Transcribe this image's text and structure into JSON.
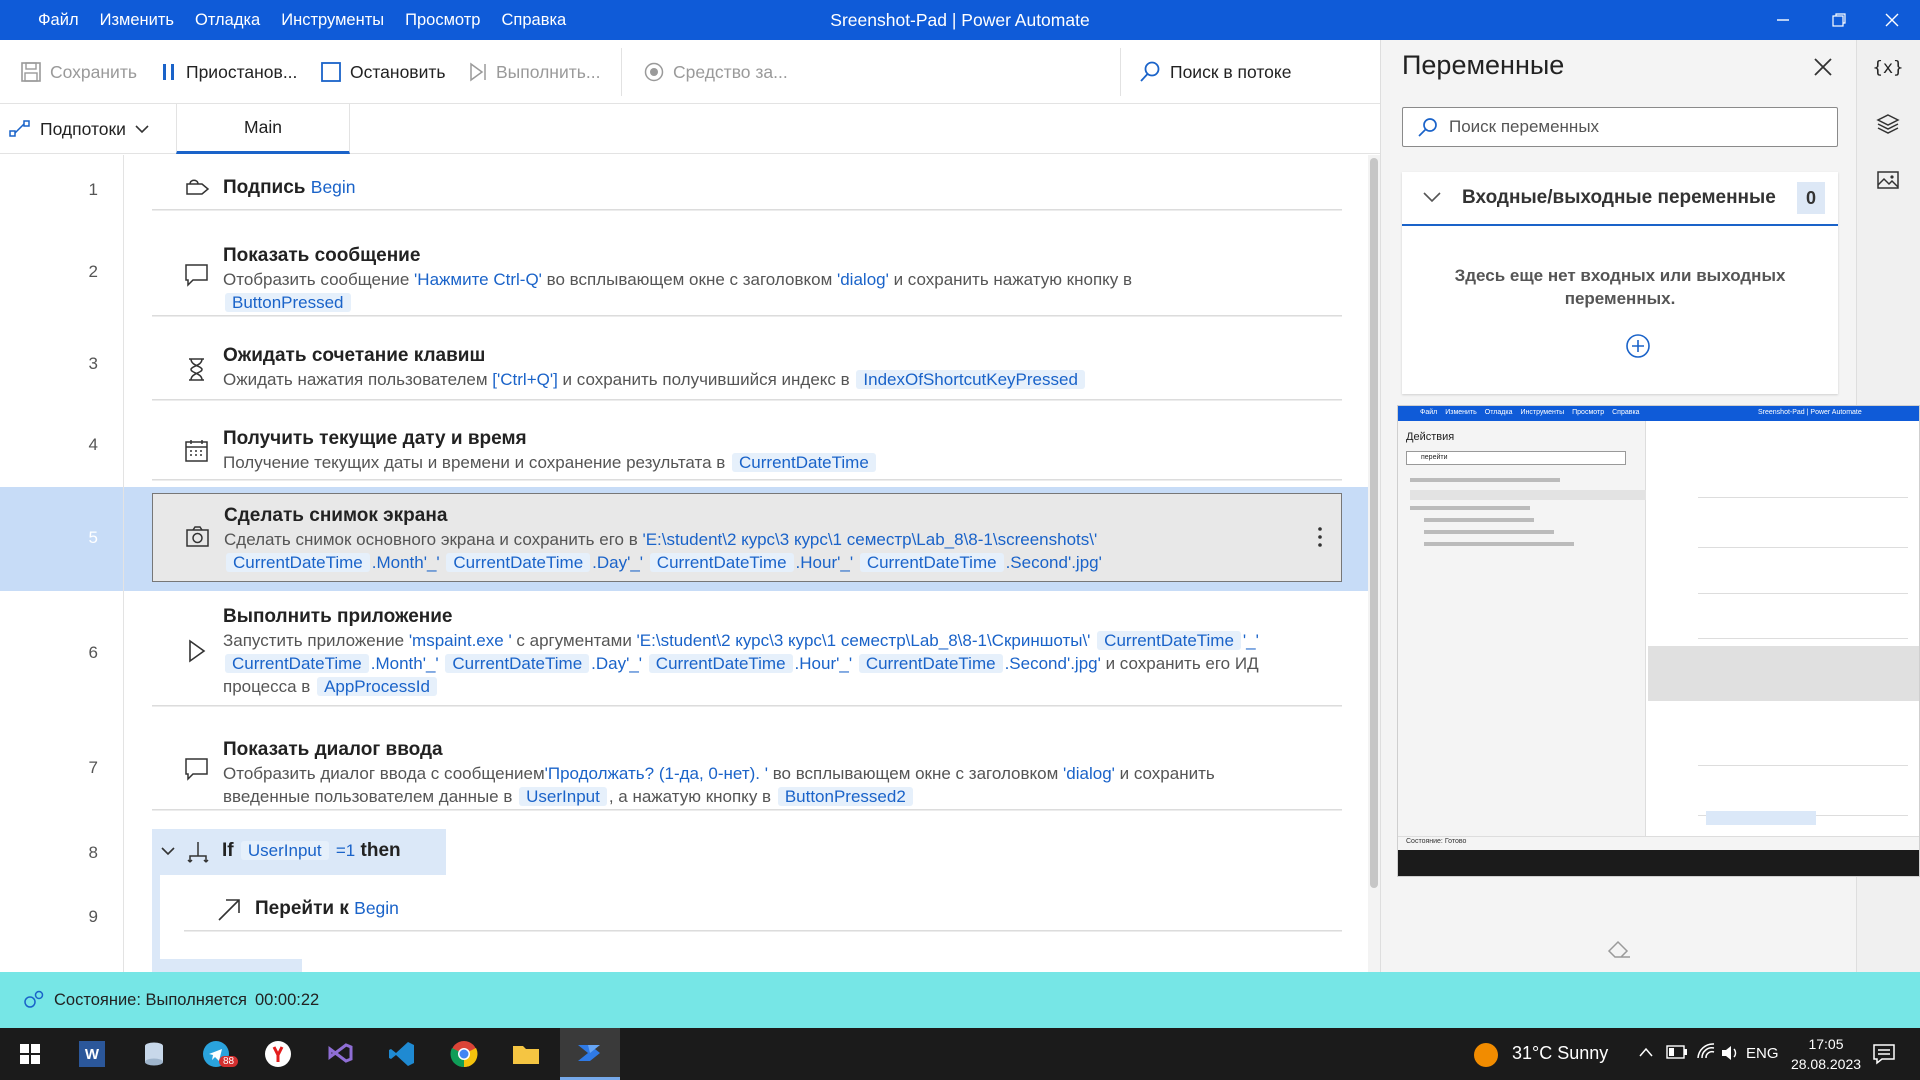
{
  "window": {
    "title": "Sreenshot-Pad | Power Automate",
    "menu": [
      "Файл",
      "Изменить",
      "Отладка",
      "Инструменты",
      "Просмотр",
      "Справка"
    ]
  },
  "toolbar": {
    "save": "Сохранить",
    "pause": "Приостанов...",
    "stop": "Остановить",
    "run": "Выполнить...",
    "recorder": "Средство за...",
    "search": "Поиск в потоке"
  },
  "tabs": {
    "subflows": "Подпотоки",
    "main": "Main"
  },
  "steps": [
    {
      "n": "1",
      "title": "Подпись",
      "arg": "Begin"
    },
    {
      "n": "2",
      "title": "Показать сообщение",
      "d1": "Отобразить сообщение ",
      "v1": "'Нажмите Ctrl-Q'",
      "d2": " во всплывающем окне с заголовком ",
      "v2": "'dialog'",
      "d3": " и сохранить нажатую кнопку в",
      "t1": "ButtonPressed"
    },
    {
      "n": "3",
      "title": "Ожидать сочетание клавиш",
      "d1": "Ожидать нажатия пользователем ",
      "v1": "['Ctrl+Q']",
      "d2": " и сохранить получившийся индекс в",
      "t1": "IndexOfShortcutKeyPressed"
    },
    {
      "n": "4",
      "title": "Получить текущие дату и время",
      "d1": "Получение текущих даты и времени и сохранение результата в",
      "t1": "CurrentDateTime"
    },
    {
      "n": "5",
      "title": "Сделать снимок экрана",
      "d1": "Сделать снимок основного экрана и сохранить его в ",
      "v1": "'E:\\student\\2 курс\\3 курс\\1 семестр\\Lab_8\\8-1\\screenshots\\'",
      "t1": "CurrentDateTime",
      "v2": ".Month'_'",
      "t2": "CurrentDateTime",
      "v3": ".Day'_'",
      "t3": "CurrentDateTime",
      "v4": ".Hour'_'",
      "t4": "CurrentDateTime",
      "v5": ".Second'.jpg'"
    },
    {
      "n": "6",
      "title": "Выполнить приложение",
      "d1": "Запустить приложение ",
      "v1": "'mspaint.exe '",
      "d2": " с аргументами ",
      "v2": "'E:\\student\\2 курс\\3 курс\\1 семестр\\Lab_8\\8-1\\Скриншоты\\'",
      "t1": "CurrentDateTime",
      "v3": "'_'",
      "t2": "CurrentDateTime",
      "v4": ".Month'_'",
      "t3": "CurrentDateTime",
      "v5": ".Day'_'",
      "t4": "CurrentDateTime",
      "v6": ".Hour'_'",
      "t5": "CurrentDateTime",
      "v7": ".Second'.jpg'",
      "d3": " и сохранить его ИД",
      "d4": "процесса в",
      "t6": "AppProcessId"
    },
    {
      "n": "7",
      "title": "Показать диалог ввода",
      "d1": "Отобразить диалог ввода с сообщением",
      "v1": "'Продолжать? (1-да, 0-нет). '",
      "d2": " во всплывающем окне с заголовком ",
      "v2": "'dialog'",
      "d3": " и сохранить",
      "d4": "введенные пользователем данные в",
      "t1": "UserInput",
      "d5": ", а нажатую кнопку в",
      "t2": "ButtonPressed2"
    },
    {
      "n": "8",
      "kw": "If",
      "t1": "UserInput",
      "v1": "=1",
      "kw2": "then"
    },
    {
      "n": "9",
      "title": "Перейти к",
      "arg": "Begin"
    }
  ],
  "variables": {
    "title": "Переменные",
    "search": "Поиск переменных",
    "io_header": "Входные/выходные переменные",
    "io_count": "0",
    "io_empty": "Здесь еще нет входных или выходных переменных."
  },
  "thumbnail": {
    "menu": [
      "Файл",
      "Изменить",
      "Отладка",
      "Инструменты",
      "Просмотр",
      "Справка"
    ],
    "title": "Sreenshot-Pad | Power Automate",
    "actions_title": "Действия",
    "search": "перейти",
    "status": "Состояние: Готово"
  },
  "status": {
    "text": "Состояние: Выполняется",
    "time": "00:00:22"
  },
  "taskbar": {
    "weather": "31°C  Sunny",
    "lang": "ENG",
    "time": "17:05",
    "date": "28.08.2023",
    "badge": "88"
  },
  "colors": {
    "accent": "#0f5bd8",
    "status": "#76e6e6",
    "selected": "#c7dcf7"
  }
}
